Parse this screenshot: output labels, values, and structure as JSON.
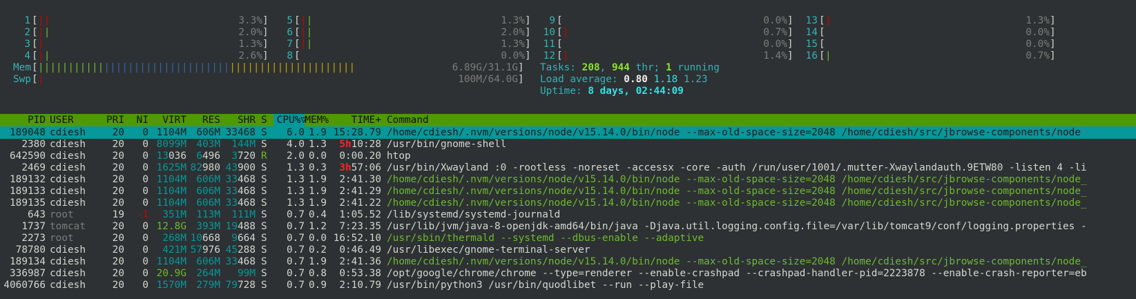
{
  "cpus": [
    {
      "id": "1",
      "pct": "3.3%",
      "bars": [
        {
          "t": "|",
          "c": "red"
        },
        {
          "t": "|",
          "c": "red"
        }
      ]
    },
    {
      "id": "2",
      "pct": "2.0%",
      "bars": [
        {
          "t": "|",
          "c": "red"
        },
        {
          "t": "|",
          "c": "green"
        }
      ]
    },
    {
      "id": "3",
      "pct": "1.3%",
      "bars": [
        {
          "t": "|",
          "c": "red"
        }
      ]
    },
    {
      "id": "4",
      "pct": "2.6%",
      "bars": [
        {
          "t": "|",
          "c": "red"
        },
        {
          "t": "|",
          "c": "green"
        }
      ]
    },
    {
      "id": "5",
      "pct": "1.3%",
      "bars": [
        {
          "t": "|",
          "c": "red"
        },
        {
          "t": "|",
          "c": "green"
        }
      ]
    },
    {
      "id": "6",
      "pct": "2.0%",
      "bars": [
        {
          "t": "|",
          "c": "red"
        },
        {
          "t": "|",
          "c": "green"
        }
      ]
    },
    {
      "id": "7",
      "pct": "1.3%",
      "bars": [
        {
          "t": "|",
          "c": "red"
        },
        {
          "t": "|",
          "c": "green"
        }
      ]
    },
    {
      "id": "8",
      "pct": "0.0%",
      "bars": []
    },
    {
      "id": "9",
      "pct": "0.0%",
      "bars": []
    },
    {
      "id": "10",
      "pct": "0.7%",
      "bars": [
        {
          "t": "|",
          "c": "red"
        }
      ]
    },
    {
      "id": "11",
      "pct": "0.0%",
      "bars": []
    },
    {
      "id": "12",
      "pct": "1.4%",
      "bars": [
        {
          "t": "|",
          "c": "red"
        }
      ]
    },
    {
      "id": "13",
      "pct": "1.3%",
      "bars": [
        {
          "t": "|",
          "c": "red"
        }
      ]
    },
    {
      "id": "14",
      "pct": "0.0%",
      "bars": []
    },
    {
      "id": "15",
      "pct": "0.0%",
      "bars": []
    },
    {
      "id": "16",
      "pct": "0.7%",
      "bars": [
        {
          "t": "|",
          "c": "green"
        }
      ]
    }
  ],
  "mem": {
    "label": "Mem",
    "value": "6.89G/31.1G",
    "bars_green": 11,
    "bars_blue": 21,
    "bars_yellow": 21
  },
  "swp": {
    "label": "Swp",
    "value": "100M/64.0G",
    "bars_red": 1
  },
  "tasks": {
    "label": "Tasks: ",
    "count": "208",
    "sep1": ", ",
    "threads": "944",
    "thr": " thr; ",
    "running": "1",
    "running_label": " running"
  },
  "load": {
    "label": "Load average: ",
    "l1": "0.80",
    "l5": "1.18",
    "l15": "1.23"
  },
  "uptime": {
    "label": "Uptime: ",
    "value": "8 days, 02:44:09"
  },
  "columns": {
    "pid": "PID",
    "user": "USER",
    "pri": "PRI",
    "ni": "NI",
    "virt": "VIRT",
    "res": "RES",
    "shr": "SHR",
    "s": "S",
    "cpu": "CPU%▽",
    "mem": "MEM%",
    "time": "TIME+",
    "cmd": "Command"
  },
  "processes": [
    {
      "pid": "189048",
      "user": "cdiesh",
      "pri": "20",
      "ni": "0",
      "virt": "1104M",
      "res": "606M",
      "shr": "33468",
      "s": "S",
      "cpu": "6.0",
      "mem": "1.9",
      "time": "15:28.79",
      "cmd": "/home/cdiesh/.nvm/versions/node/v15.14.0/bin/node --max-old-space-size=2048 /home/cdiesh/src/jbrowse-components/node",
      "selected": true
    },
    {
      "pid": "2380",
      "user": "cdiesh",
      "pri": "20",
      "ni": "0",
      "virt": "8099M",
      "res": "403M",
      "shr": "144M",
      "s": "S",
      "cpu": "4.0",
      "mem": "1.3",
      "time": "5h10:28",
      "cmd": "/usr/bin/gnome-shell"
    },
    {
      "pid": "642590",
      "user": "cdiesh",
      "pri": "20",
      "ni": "0",
      "virt": "13036",
      "res": "6496",
      "shr": "3720",
      "s": "R",
      "cpu": "2.0",
      "mem": "0.0",
      "time": "0:00.20",
      "cmd": "htop"
    },
    {
      "pid": "2469",
      "user": "cdiesh",
      "pri": "20",
      "ni": "0",
      "virt": "1625M",
      "res": "82980",
      "shr": "43900",
      "s": "S",
      "cpu": "1.3",
      "mem": "0.3",
      "time": "3h57:06",
      "cmd": "/usr/bin/Xwayland :0 -rootless -noreset -accessx -core -auth /run/user/1001/.mutter-Xwaylandauth.9ETW80 -listen 4 -li"
    },
    {
      "pid": "189132",
      "user": "cdiesh",
      "pri": "20",
      "ni": "0",
      "virt": "1104M",
      "res": "606M",
      "shr": "33468",
      "s": "S",
      "cpu": "1.3",
      "mem": "1.9",
      "time": "2:41.30",
      "cmd": "/home/cdiesh/.nvm/versions/node/v15.14.0/bin/node --max-old-space-size=2048 /home/cdiesh/src/jbrowse-components/node_",
      "thread": true
    },
    {
      "pid": "189133",
      "user": "cdiesh",
      "pri": "20",
      "ni": "0",
      "virt": "1104M",
      "res": "606M",
      "shr": "33468",
      "s": "S",
      "cpu": "1.3",
      "mem": "1.9",
      "time": "2:41.29",
      "cmd": "/home/cdiesh/.nvm/versions/node/v15.14.0/bin/node --max-old-space-size=2048 /home/cdiesh/src/jbrowse-components/node_",
      "thread": true
    },
    {
      "pid": "189135",
      "user": "cdiesh",
      "pri": "20",
      "ni": "0",
      "virt": "1104M",
      "res": "606M",
      "shr": "33468",
      "s": "S",
      "cpu": "1.3",
      "mem": "1.9",
      "time": "2:41.22",
      "cmd": "/home/cdiesh/.nvm/versions/node/v15.14.0/bin/node --max-old-space-size=2048 /home/cdiesh/src/jbrowse-components/node_",
      "thread": true
    },
    {
      "pid": "643",
      "user": "root",
      "pri": "19",
      "ni": "-1",
      "virt": "351M",
      "res": "113M",
      "shr": "111M",
      "s": "S",
      "cpu": "0.7",
      "mem": "0.4",
      "time": "1:05.52",
      "cmd": "/lib/systemd/systemd-journald",
      "dimuser": true
    },
    {
      "pid": "1737",
      "user": "tomcat",
      "pri": "20",
      "ni": "0",
      "virt": "12.8G",
      "res": "393M",
      "shr": "19488",
      "s": "S",
      "cpu": "0.7",
      "mem": "1.2",
      "time": "7:23.35",
      "cmd": "/usr/lib/jvm/java-8-openjdk-amd64/bin/java -Djava.util.logging.config.file=/var/lib/tomcat9/conf/logging.properties -",
      "dimuser": true
    },
    {
      "pid": "2273",
      "user": "root",
      "pri": "20",
      "ni": "0",
      "virt": "268M",
      "res": "10668",
      "shr": "9664",
      "s": "S",
      "cpu": "0.7",
      "mem": "0.0",
      "time": "16:52.10",
      "cmd": "/usr/sbin/thermald --systemd --dbus-enable --adaptive",
      "dimuser": true,
      "thread": true
    },
    {
      "pid": "78780",
      "user": "cdiesh",
      "pri": "20",
      "ni": "0",
      "virt": "421M",
      "res": "57976",
      "shr": "45288",
      "s": "S",
      "cpu": "0.7",
      "mem": "0.2",
      "time": "0:46.49",
      "cmd": "/usr/libexec/gnome-terminal-server"
    },
    {
      "pid": "189134",
      "user": "cdiesh",
      "pri": "20",
      "ni": "0",
      "virt": "1104M",
      "res": "606M",
      "shr": "33468",
      "s": "S",
      "cpu": "0.7",
      "mem": "1.9",
      "time": "2:41.36",
      "cmd": "/home/cdiesh/.nvm/versions/node/v15.14.0/bin/node --max-old-space-size=2048 /home/cdiesh/src/jbrowse-components/node_",
      "thread": true
    },
    {
      "pid": "336987",
      "user": "cdiesh",
      "pri": "20",
      "ni": "0",
      "virt": "20.9G",
      "res": "264M",
      "shr": "99M",
      "s": "S",
      "cpu": "0.7",
      "mem": "0.8",
      "time": "0:53.38",
      "cmd": "/opt/google/chrome/chrome --type=renderer --enable-crashpad --crashpad-handler-pid=2223878 --enable-crash-reporter=eb"
    },
    {
      "pid": "4060766",
      "user": "cdiesh",
      "pri": "20",
      "ni": "0",
      "virt": "1570M",
      "res": "279M",
      "shr": "79728",
      "s": "S",
      "cpu": "0.7",
      "mem": "0.9",
      "time": "2:10.79",
      "cmd": "/usr/bin/python3 /usr/bin/quodlibet --run --play-file"
    }
  ],
  "colors": {
    "bg": "#2d3133",
    "header": "#4e9a06",
    "selection": "#06989a",
    "label": "#34b3b6"
  }
}
